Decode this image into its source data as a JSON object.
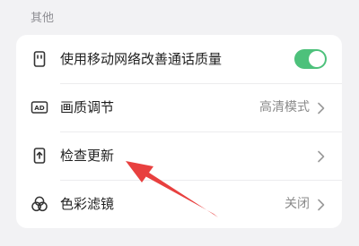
{
  "section": {
    "title": "其他"
  },
  "settings": {
    "items": [
      {
        "icon": "phone-signal-icon",
        "label": "使用移动网络改善通话质量",
        "control": "toggle",
        "toggle_on": true
      },
      {
        "icon": "ad-icon",
        "label": "画质调节",
        "value": "高清模式",
        "control": "chevron",
        "icon_text": "AD"
      },
      {
        "icon": "phone-upload-icon",
        "label": "检查更新",
        "control": "chevron"
      },
      {
        "icon": "color-filter-icon",
        "label": "色彩滤镜",
        "value": "关闭",
        "control": "chevron"
      }
    ]
  },
  "colors": {
    "background": "#f2f2f4",
    "card": "#ffffff",
    "toggle_on": "#4dc17b",
    "annotation_arrow": "#e8403f"
  }
}
